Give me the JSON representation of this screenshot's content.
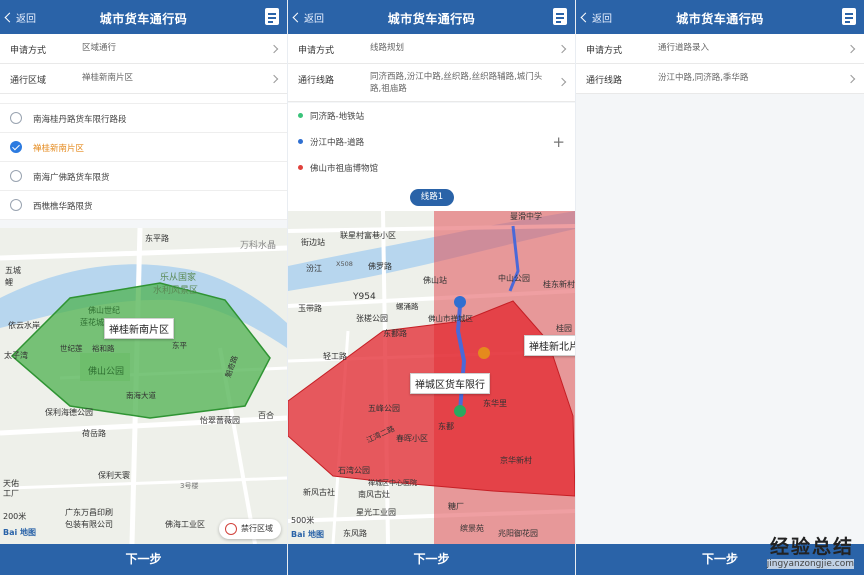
{
  "app": {
    "title": "城市货车通行码",
    "back": "返回",
    "next": "下一步"
  },
  "screen1": {
    "apply_label": "申请方式",
    "apply_value": "区域通行",
    "zone_label": "通行区域",
    "zone_value": "禅桂新南片区",
    "options": [
      {
        "label": "南海桂丹路货车限行路段",
        "selected": false
      },
      {
        "label": "禅桂新南片区",
        "selected": true
      },
      {
        "label": "南海广佛路货车限货",
        "selected": false
      },
      {
        "label": "西樵樵华路限货",
        "selected": false
      }
    ],
    "map_callout": "禅桂新南片区",
    "map_labels": [
      "东平路",
      "万科水晶",
      "乐从国家",
      "水利风景区",
      "佛山世纪",
      "莲花城市",
      "依云水岸",
      "世纪莲",
      "裕和路",
      "东平",
      "太子湾",
      "佛山公园",
      "魁奇路",
      "保利海德公园",
      "荷岳路",
      "南海大道",
      "怡翠蔷薇园",
      "百合",
      "保利天寰",
      "广东万昌印刷",
      "包装有限公司",
      "佛海工业区",
      "天佑",
      "工厂",
      "3号楼",
      "五城",
      "鲤"
    ],
    "scale": "200米",
    "zone_button": "禁行区域",
    "baidu": "Bai 地图"
  },
  "screen2": {
    "apply_label": "申请方式",
    "apply_value": "线路规划",
    "route_label": "通行线路",
    "route_value": "同济西路,汾江中路,丝织路,丝织路辅路,城门头路,祖庙路",
    "stops": [
      {
        "label": "同济路-地铁站",
        "color": "#3ac37a"
      },
      {
        "label": "汾江中路-道路",
        "color": "#2f6fd1"
      },
      {
        "label": "佛山市祖庙博物馆",
        "color": "#e0413c"
      }
    ],
    "route_pill": "线路1",
    "callout_main": "禅城区货车限行",
    "callout_right": "禅桂新北片",
    "map_labels": [
      "街边站",
      "联星村富巷小区",
      "曼滑中学",
      "X508",
      "佛罗路",
      "汾江",
      "中山公园",
      "佛山站",
      "Y954",
      "螺涌路",
      "桂东新村",
      "玉带路",
      "张槎公园",
      "东鄱路",
      "佛山市禅城区",
      "桂园",
      "轻工路",
      "五峰公园",
      "东华里",
      "江湾二路",
      "春晖小区",
      "石湾公园",
      "东鄱",
      "京华新村",
      "新风古社",
      "南风古灶",
      "禅城区中心医院",
      "星光工业园",
      "东风路",
      "糖厂",
      "缤景苑",
      "兆阳御花园"
    ],
    "scale": "500米",
    "baidu": "Bai 地图"
  },
  "screen3": {
    "apply_label": "申请方式",
    "apply_value": "通行道路录入",
    "route_label": "通行线路",
    "route_value": "汾江中路,同济路,季华路"
  },
  "watermark": {
    "main": "经验总结",
    "url": "jingyanzongjie.com"
  }
}
